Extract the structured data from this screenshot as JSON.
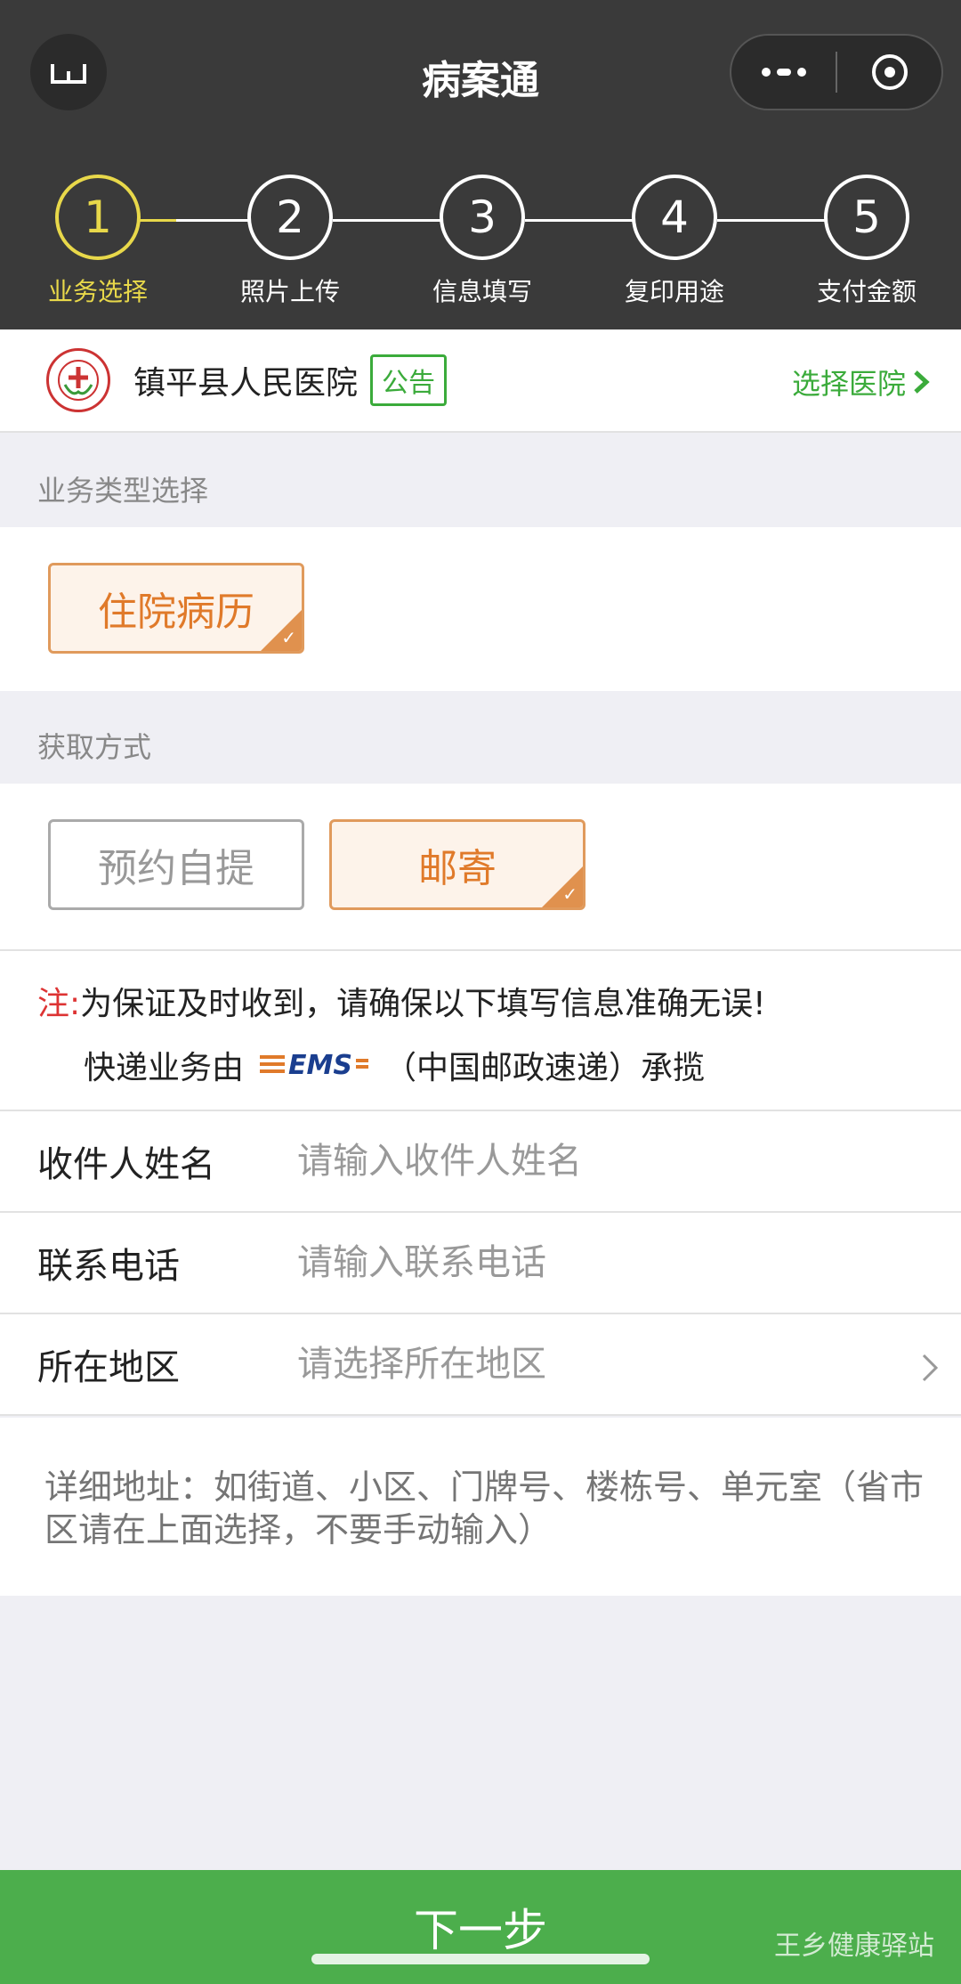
{
  "header": {
    "title": "病案通"
  },
  "steps": [
    {
      "num": "1",
      "label": "业务选择",
      "active": true
    },
    {
      "num": "2",
      "label": "照片上传",
      "active": false
    },
    {
      "num": "3",
      "label": "信息填写",
      "active": false
    },
    {
      "num": "4",
      "label": "复印用途",
      "active": false
    },
    {
      "num": "5",
      "label": "支付金额",
      "active": false
    }
  ],
  "hospital": {
    "name": "镇平县人民医院",
    "notice_label": "公告",
    "choose_label": "选择医院"
  },
  "business_type": {
    "title": "业务类型选择",
    "options": [
      {
        "label": "住院病历",
        "selected": true
      }
    ]
  },
  "pickup": {
    "title": "获取方式",
    "options": [
      {
        "label": "预约自提",
        "selected": false
      },
      {
        "label": "邮寄",
        "selected": true
      }
    ]
  },
  "note": {
    "prefix": "注:",
    "text": "为保证及时收到，请确保以下填写信息准确无误!",
    "line2_before": "快递业务由",
    "logo_text": "EMS",
    "line2_after": "（中国邮政速递）承揽"
  },
  "form": {
    "recipient": {
      "label": "收件人姓名",
      "placeholder": "请输入收件人姓名"
    },
    "phone": {
      "label": "联系电话",
      "placeholder": "请输入联系电话"
    },
    "region": {
      "label": "所在地区",
      "placeholder": "请选择所在地区"
    },
    "address": {
      "placeholder": "详细地址：如街道、小区、门牌号、楼栋号、单元室（省市区请在上面选择，不要手动输入）"
    }
  },
  "footer": {
    "next_label": "下一步",
    "watermark": "王乡健康驿站"
  },
  "colors": {
    "header_bg": "#3a3a3a",
    "step_active": "#e8d84a",
    "accent_green": "#4cae4c",
    "selected_orange": "#e07a2a",
    "note_red": "#d33"
  },
  "icons": {
    "home": "home-icon",
    "more": "more-dots-icon",
    "close": "close-target-icon",
    "chevron": "chevron-right-icon",
    "check": "check-icon"
  }
}
